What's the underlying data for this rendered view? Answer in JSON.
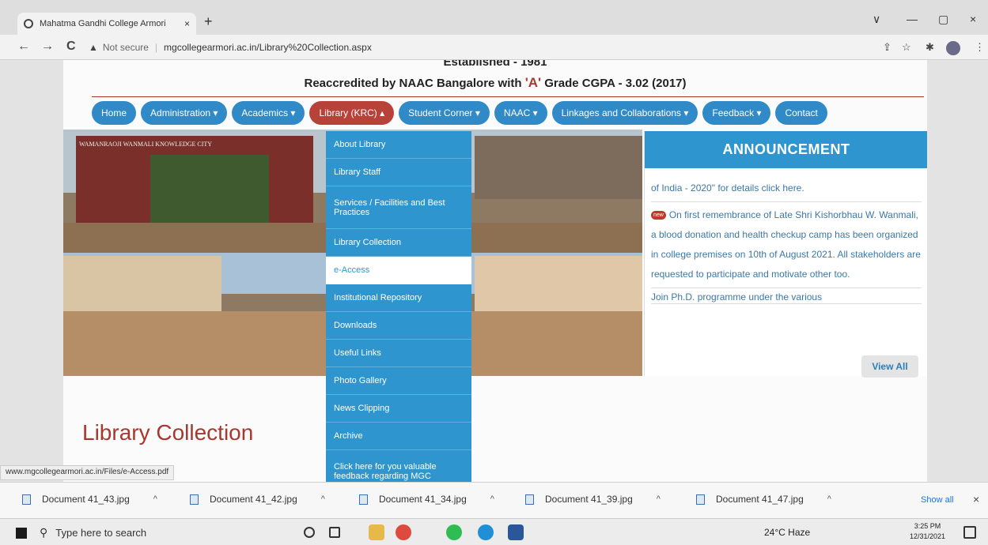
{
  "browser": {
    "tab_title": "Mahatma Gandhi College Armori",
    "tab_close": "×",
    "new_tab": "+",
    "back": "←",
    "forward": "→",
    "reload": "C",
    "security_label": "Not secure",
    "url": "mgcollegearmori.ac.in/Library%20Collection.aspx",
    "minimize": "—",
    "maximize": "▢",
    "close": "×",
    "dropdown_arrow": "∨"
  },
  "header": {
    "established": "Established - 1981",
    "accreditation_pre": "Reaccredited by NAAC Bangalore with ",
    "accreditation_grade": "'A'",
    "accreditation_post": " Grade CGPA - 3.02 (2017)"
  },
  "nav": {
    "items": [
      {
        "label": "Home"
      },
      {
        "label": "Administration ▾"
      },
      {
        "label": "Academics ▾"
      },
      {
        "label": "Library (KRC) ▴"
      },
      {
        "label": "Student Corner ▾"
      },
      {
        "label": "NAAC ▾"
      },
      {
        "label": "Linkages and Collaborations ▾"
      },
      {
        "label": "Feedback ▾"
      },
      {
        "label": "Contact"
      }
    ]
  },
  "hero": {
    "gate_text": "WAMANRAOJI WANMALI  KNOWLEDGE CITY"
  },
  "dropdown": {
    "items": [
      {
        "label": "About Library"
      },
      {
        "label": "Library Staff"
      },
      {
        "label": "Services / Facilities and Best Practices"
      },
      {
        "label": "Library Collection"
      },
      {
        "label": "e-Access"
      },
      {
        "label": "Institutional Repository"
      },
      {
        "label": "Downloads"
      },
      {
        "label": "Useful Links"
      },
      {
        "label": "Photo Gallery"
      },
      {
        "label": "News Clipping"
      },
      {
        "label": "Archive"
      },
      {
        "label": "Click here for you valuable feedback regarding MGC"
      }
    ]
  },
  "announcement": {
    "heading": "ANNOUNCEMENT",
    "item1": "of India - 2020\" for details click here.",
    "new_badge": "new",
    "item2": "On first remembrance of Late Shri Kishorbhau W. Wanmali, a blood donation and health checkup camp has been organized in college premises on 10th of August 2021. All stakeholders are requested to participate and motivate other too.",
    "item3": "Join Ph.D. programme under the various",
    "view_all": "View All"
  },
  "main": {
    "page_title": "Library Collection"
  },
  "status_link": "www.mgcollegearmori.ac.in/Files/e-Access.pdf",
  "downloads": {
    "files": [
      {
        "name": "Document 41_43.jpg"
      },
      {
        "name": "Document 41_42.jpg"
      },
      {
        "name": "Document 41_34.jpg"
      },
      {
        "name": "Document 41_39.jpg"
      },
      {
        "name": "Document 41_47.jpg"
      }
    ],
    "chevron": "^",
    "show_all": "Show all",
    "close": "×"
  },
  "taskbar": {
    "search_placeholder": "Type here to search",
    "weather": "24°C  Haze",
    "time": "3:25 PM",
    "date": "12/31/2021"
  }
}
